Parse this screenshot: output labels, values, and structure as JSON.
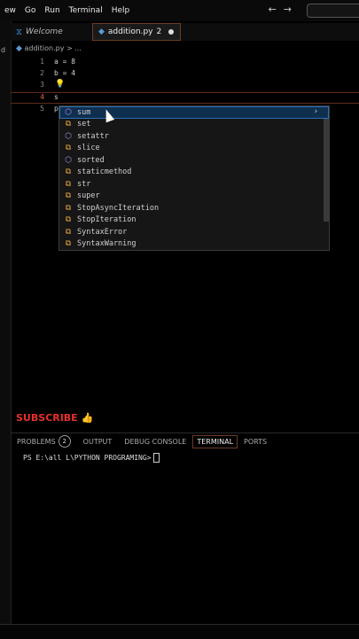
{
  "menu": {
    "items": [
      "ew",
      "Go",
      "Run",
      "Terminal",
      "Help"
    ],
    "back": "←",
    "forward": "→"
  },
  "tabs": [
    {
      "label": "Welcome",
      "icon": "vscode-icon"
    },
    {
      "label": "addition.py",
      "count": "2",
      "icon": "python-icon"
    }
  ],
  "left_edge_char": "d",
  "breadcrumb": "addition.py > ...",
  "editor": {
    "lines": [
      {
        "num": "1",
        "code": "a = 8"
      },
      {
        "num": "2",
        "code": "b = 4"
      },
      {
        "num": "3",
        "code": ""
      },
      {
        "num": "4",
        "code": "s"
      },
      {
        "num": "5",
        "code": "p"
      }
    ]
  },
  "suggestions": [
    {
      "label": "sum",
      "kind": "function"
    },
    {
      "label": "set",
      "kind": "class"
    },
    {
      "label": "setattr",
      "kind": "function"
    },
    {
      "label": "slice",
      "kind": "class"
    },
    {
      "label": "sorted",
      "kind": "function"
    },
    {
      "label": "staticmethod",
      "kind": "class"
    },
    {
      "label": "str",
      "kind": "class"
    },
    {
      "label": "super",
      "kind": "class"
    },
    {
      "label": "StopAsyncIteration",
      "kind": "class"
    },
    {
      "label": "StopIteration",
      "kind": "class"
    },
    {
      "label": "SyntaxError",
      "kind": "class"
    },
    {
      "label": "SyntaxWarning",
      "kind": "class"
    }
  ],
  "overlay": {
    "subscribe": "SUBSCRIBE 👍"
  },
  "panel": {
    "problems": "PROBLEMS",
    "problems_count": "2",
    "output": "OUTPUT",
    "debug": "DEBUG CONSOLE",
    "terminal": "TERMINAL",
    "ports": "PORTS"
  },
  "terminal": {
    "prompt": "PS E:\\all L\\PYTHON   PROGRAMING>"
  },
  "colors": {
    "accent_border": "#6b3b22",
    "selection": "#0f2f4f",
    "subscribe": "#e5322b"
  }
}
